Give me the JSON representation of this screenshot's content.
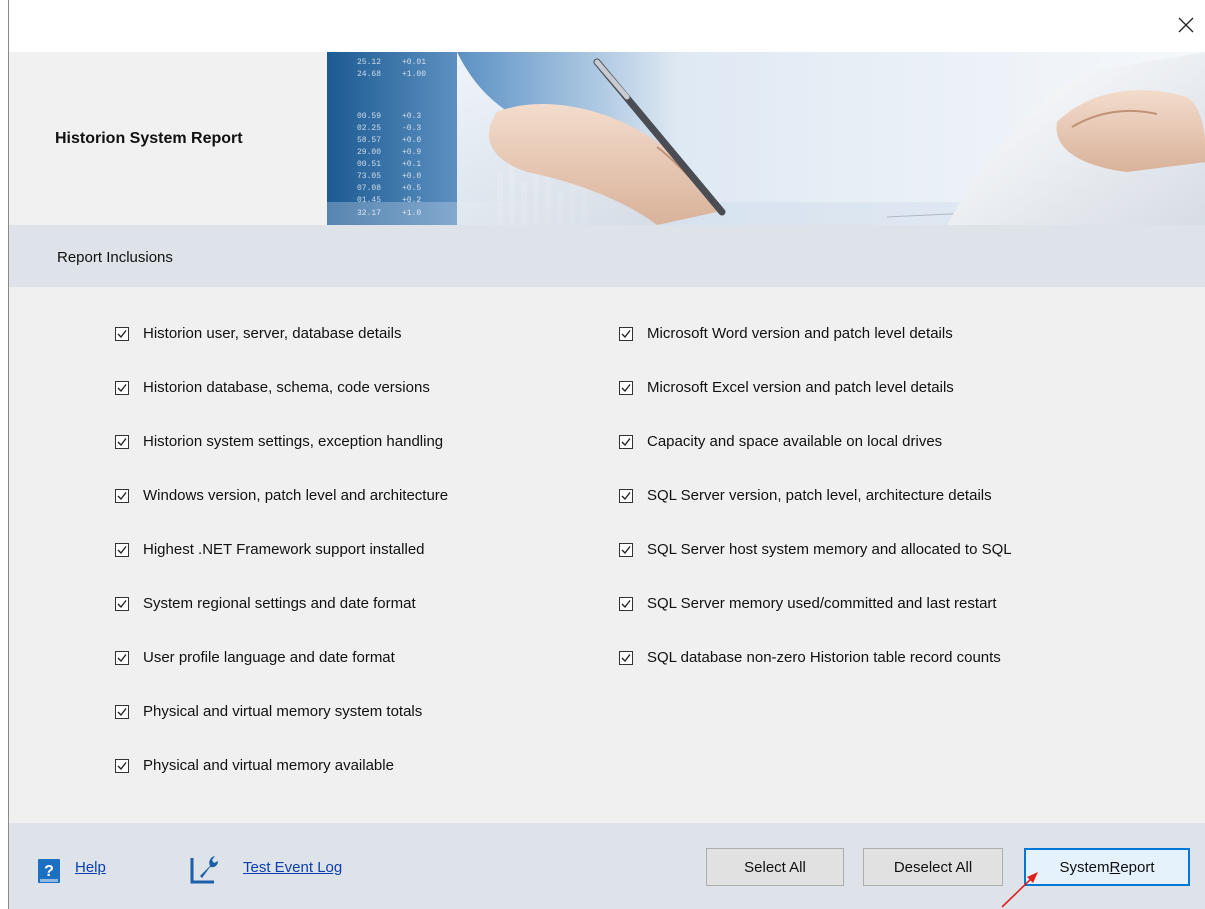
{
  "window": {
    "close_icon": "close-icon"
  },
  "header": {
    "title": "Historion System Report",
    "banner_numbers_left": [
      "25.12",
      "24.68",
      "00.59",
      "02.25",
      "58.57",
      "29.00",
      "00.51",
      "73.05",
      "07.08",
      "01.45",
      "32.17"
    ],
    "banner_numbers_right": [
      "+0.01",
      "+1.00",
      "+0.3",
      "-0.3",
      "+0.0",
      "+0.9",
      "+0.1",
      "+0.0",
      "+0.5",
      "+0.2",
      "+1.0"
    ]
  },
  "section": {
    "title": "Report Inclusions"
  },
  "options": {
    "left": [
      {
        "label": "Historion user, server, database details",
        "checked": true
      },
      {
        "label": "Historion database, schema, code versions",
        "checked": true
      },
      {
        "label": "Historion system settings, exception handling",
        "checked": true
      },
      {
        "label": "Windows version, patch level and architecture",
        "checked": true
      },
      {
        "label": "Highest .NET Framework support installed",
        "checked": true
      },
      {
        "label": "System regional settings and date format",
        "checked": true
      },
      {
        "label": "User profile language and date format",
        "checked": true
      },
      {
        "label": "Physical and virtual memory system totals",
        "checked": true
      },
      {
        "label": "Physical and virtual memory available",
        "checked": true
      }
    ],
    "right": [
      {
        "label": "Microsoft Word version and patch level details",
        "checked": true
      },
      {
        "label": "Microsoft Excel version and patch level details",
        "checked": true
      },
      {
        "label": "Capacity and space available on local drives",
        "checked": true
      },
      {
        "label": "SQL Server version, patch level, architecture details",
        "checked": true
      },
      {
        "label": "SQL Server host system memory and allocated to SQL",
        "checked": true
      },
      {
        "label": "SQL Server memory used/committed and last restart",
        "checked": true
      },
      {
        "label": "SQL database non-zero Historion table record counts",
        "checked": true
      }
    ]
  },
  "footer": {
    "help_label": "Help",
    "log_label": "Test Event Log",
    "select_all_label": "Select All",
    "deselect_all_label": "Deselect All",
    "report_label_pre": "System ",
    "report_label_mnemonic": "R",
    "report_label_post": "eport"
  },
  "colors": {
    "link": "#0b3fae",
    "accent_border": "#0078d7",
    "section_bar": "#dde3e8",
    "arrow": "#e0201b"
  }
}
